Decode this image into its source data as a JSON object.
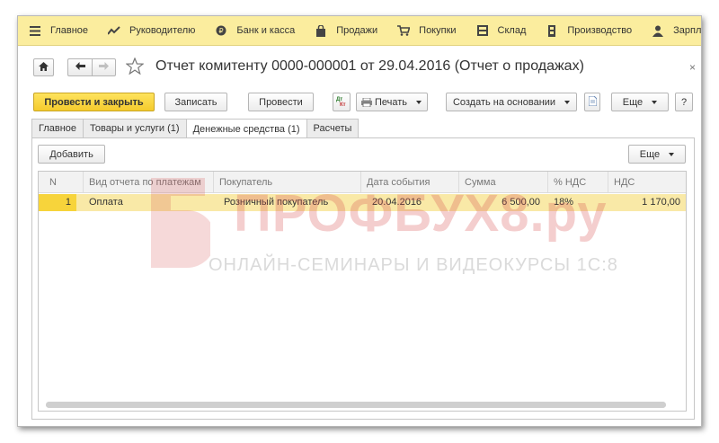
{
  "sections": [
    {
      "label": "Главное",
      "icon": "menu-lines-icon"
    },
    {
      "label": "Руководителю",
      "icon": "trend-chart-icon"
    },
    {
      "label": "Банк и касса",
      "icon": "coins-icon"
    },
    {
      "label": "Продажи",
      "icon": "shopping-bag-icon"
    },
    {
      "label": "Покупки",
      "icon": "cart-icon"
    },
    {
      "label": "Склад",
      "icon": "warehouse-icon"
    },
    {
      "label": "Производство",
      "icon": "factory-icon"
    },
    {
      "label": "Зарплата и к",
      "icon": "person-icon"
    }
  ],
  "document": {
    "title": "Отчет комитенту 0000-000001 от 29.04.2016 (Отчет о продажах)",
    "close_symbol": "×"
  },
  "toolbar": {
    "post_and_close": "Провести и закрыть",
    "save": "Записать",
    "post": "Провести",
    "print": "Печать",
    "create_based_on": "Создать на основании",
    "more": "Еще",
    "help": "?"
  },
  "tabs": [
    {
      "label": "Главное",
      "active": false
    },
    {
      "label": "Товары и услуги (1)",
      "active": false
    },
    {
      "label": "Денежные средства (1)",
      "active": true
    },
    {
      "label": "Расчеты",
      "active": false
    }
  ],
  "panel": {
    "add_button": "Добавить",
    "more_button": "Еще"
  },
  "table": {
    "columns": [
      "N",
      "Вид отчета по платежам",
      "Покупатель",
      "Дата события",
      "Сумма",
      "% НДС",
      "НДС"
    ],
    "rows": [
      [
        "1",
        "Оплата",
        "Розничный покупатель",
        "20.04.2016",
        "6 500,00",
        "18%",
        "1 170,00"
      ]
    ]
  },
  "watermark": {
    "brand": "ПРОФБУХ8.ру",
    "tagline": "ОНЛАЙН-СЕМИНАРЫ И ВИДЕОКУРСЫ 1С:8"
  },
  "colors": {
    "section_bar": "#fbed9e",
    "primary_button": "#f5cb2d",
    "selected_row": "#f9e9a7"
  }
}
